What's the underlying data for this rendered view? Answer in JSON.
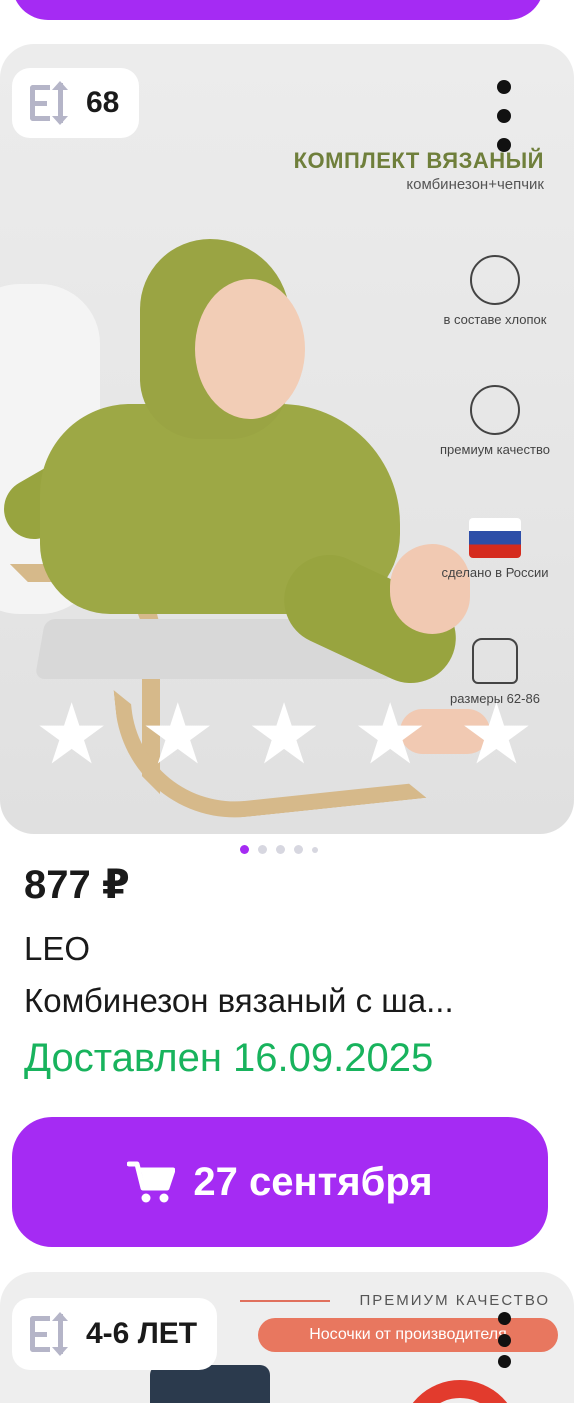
{
  "product": {
    "size_badge": "68",
    "promo_title": "КОМПЛЕКТ ВЯЗАНЫЙ",
    "promo_subtitle": "комбинезон+чепчик",
    "features": [
      {
        "label": "в составе хлопок",
        "icon": "cotton-icon"
      },
      {
        "label": "премиум качество",
        "icon": "quality-badge-icon"
      },
      {
        "label": "сделано в России",
        "icon": "russia-flag-icon"
      },
      {
        "label": "размеры 62-86",
        "icon": "clothing-size-icon"
      }
    ],
    "rating_stars": 5,
    "image_dots": {
      "count": 5,
      "active_index": 0
    },
    "price": "877 ₽",
    "brand": "LEO",
    "title": "Комбинезон вязаный с ша...",
    "delivery_status": "Доставлен 16.09.2025",
    "cart_button_label": "27 сентября"
  },
  "next_product": {
    "size_badge": "4-6 ЛЕТ",
    "promo_premium": "ПРЕМИУМ КАЧЕСТВО",
    "promo_pill": "Носочки от производителя"
  },
  "colors": {
    "accent": "#a52bf3",
    "delivered": "#18b35d",
    "badge_icon": "#b5b5c8"
  }
}
